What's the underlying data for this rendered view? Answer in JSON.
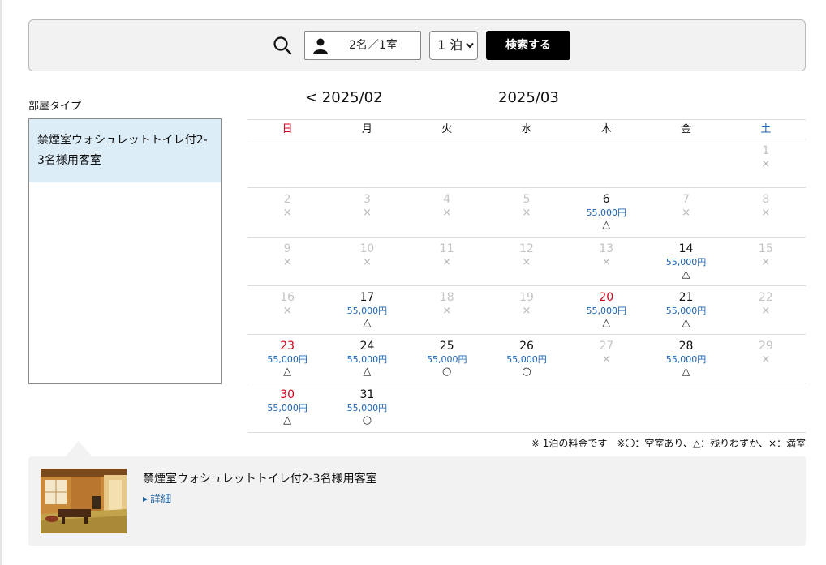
{
  "search": {
    "guests_label": "2名／1室",
    "nights_value": "1 泊",
    "button_label": "検索する"
  },
  "room_type": {
    "heading": "部屋タイプ",
    "items": [
      {
        "label": "禁煙室ウォシュレットトイレ付2-3名様用客室"
      }
    ]
  },
  "calendar": {
    "prev_month_label": "< 2025/02",
    "current_month": "2025/03",
    "weekdays": [
      "日",
      "月",
      "火",
      "水",
      "木",
      "金",
      "土"
    ],
    "weeks": [
      [
        {
          "day": "",
          "status": "empty"
        },
        {
          "day": "",
          "status": "empty"
        },
        {
          "day": "",
          "status": "empty"
        },
        {
          "day": "",
          "status": "empty"
        },
        {
          "day": "",
          "status": "empty"
        },
        {
          "day": "",
          "status": "empty"
        },
        {
          "day": "1",
          "status": "na",
          "mark": "×"
        }
      ],
      [
        {
          "day": "2",
          "status": "na",
          "mark": "×"
        },
        {
          "day": "3",
          "status": "na",
          "mark": "×"
        },
        {
          "day": "4",
          "status": "na",
          "mark": "×"
        },
        {
          "day": "5",
          "status": "na",
          "mark": "×"
        },
        {
          "day": "6",
          "status": "open",
          "price": "55,000円",
          "mark": "△"
        },
        {
          "day": "7",
          "status": "na",
          "mark": "×"
        },
        {
          "day": "8",
          "status": "na",
          "mark": "×"
        }
      ],
      [
        {
          "day": "9",
          "status": "na",
          "mark": "×"
        },
        {
          "day": "10",
          "status": "na",
          "mark": "×"
        },
        {
          "day": "11",
          "status": "na",
          "mark": "×"
        },
        {
          "day": "12",
          "status": "na",
          "mark": "×"
        },
        {
          "day": "13",
          "status": "na",
          "mark": "×"
        },
        {
          "day": "14",
          "status": "open",
          "price": "55,000円",
          "mark": "△"
        },
        {
          "day": "15",
          "status": "na",
          "mark": "×"
        }
      ],
      [
        {
          "day": "16",
          "status": "na",
          "mark": "×"
        },
        {
          "day": "17",
          "status": "open",
          "price": "55,000円",
          "mark": "△"
        },
        {
          "day": "18",
          "status": "na",
          "mark": "×"
        },
        {
          "day": "19",
          "status": "na",
          "mark": "×"
        },
        {
          "day": "20",
          "status": "open",
          "red": true,
          "price": "55,000円",
          "mark": "△"
        },
        {
          "day": "21",
          "status": "open",
          "price": "55,000円",
          "mark": "△"
        },
        {
          "day": "22",
          "status": "na",
          "mark": "×"
        }
      ],
      [
        {
          "day": "23",
          "status": "open",
          "red": true,
          "price": "55,000円",
          "mark": "△"
        },
        {
          "day": "24",
          "status": "open",
          "price": "55,000円",
          "mark": "△"
        },
        {
          "day": "25",
          "status": "open",
          "price": "55,000円",
          "mark": "○"
        },
        {
          "day": "26",
          "status": "open",
          "price": "55,000円",
          "mark": "○"
        },
        {
          "day": "27",
          "status": "na",
          "mark": "×"
        },
        {
          "day": "28",
          "status": "open",
          "price": "55,000円",
          "mark": "△"
        },
        {
          "day": "29",
          "status": "na",
          "mark": "×"
        }
      ],
      [
        {
          "day": "30",
          "status": "open",
          "red": true,
          "price": "55,000円",
          "mark": "△"
        },
        {
          "day": "31",
          "status": "open",
          "price": "55,000円",
          "mark": "○"
        },
        {
          "day": "",
          "status": "empty"
        },
        {
          "day": "",
          "status": "empty"
        },
        {
          "day": "",
          "status": "empty"
        },
        {
          "day": "",
          "status": "empty"
        },
        {
          "day": "",
          "status": "empty"
        }
      ]
    ],
    "note": "※ 1泊の料金です　※〇：空室あり、△：残りわずか、×：満室"
  },
  "room_card": {
    "title": "禁煙室ウォシュレットトイレ付2-3名様用客室",
    "detail_label": "詳細"
  },
  "colors": {
    "sunday_holiday": "#d0021b",
    "saturday": "#1a63b5",
    "price": "#1a63b5",
    "selected_room_bg": "#dcedf8",
    "button_bg": "#000000"
  }
}
